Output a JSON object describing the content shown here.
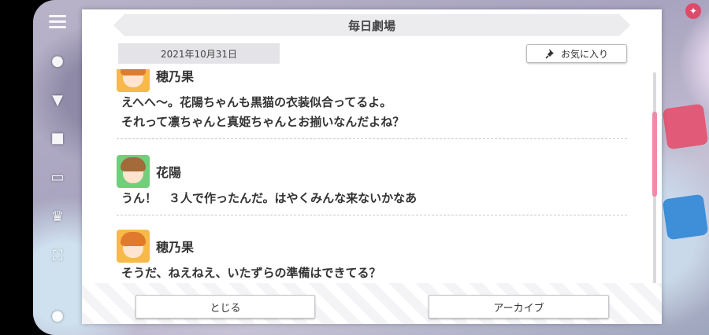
{
  "dialog": {
    "title": "毎日劇場",
    "date": "2021年10月31日",
    "favorite_label": "お気に入り"
  },
  "messages": [
    {
      "speaker": "穂乃果",
      "lines": [
        "えへへ～。花陽ちゃんも黒猫の衣装似合ってるよ。",
        "それって凛ちゃんと真姫ちゃんとお揃いなんだよね？"
      ]
    },
    {
      "speaker": "花陽",
      "lines": [
        "うん！　３人で作ったんだ。はやくみんな来ないかなあ"
      ]
    },
    {
      "speaker": "穂乃果",
      "lines": [
        "そうだ、ねえねえ、いたずらの準備はできてる？"
      ]
    }
  ],
  "buttons": {
    "close": "とじる",
    "archive": "アーカイブ"
  },
  "colors": {
    "scroll_thumb": "#f08aa8",
    "honoka_avatar_bg": "#f6b94a",
    "hanayo_avatar_bg": "#6fcf7a"
  },
  "icons": {
    "favorite": "pin-icon",
    "menu": "hamburger-icon"
  }
}
